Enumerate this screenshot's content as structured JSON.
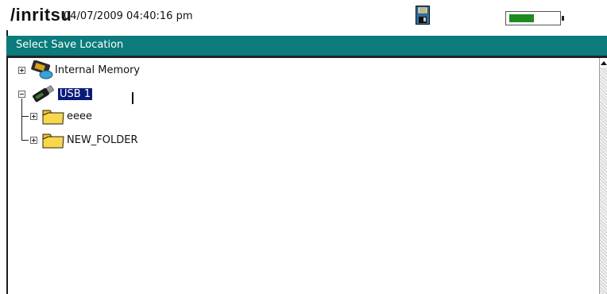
{
  "status_bar": {
    "logo": "/inritsu",
    "datetime": "04/07/2009 04:40:16 pm",
    "disk_icon": "floppy-disk-icon",
    "battery_level": 0.5,
    "battery_color": "#1f8a1f"
  },
  "dialog": {
    "title": "Select Save Location",
    "header_color": "#0b7b7b"
  },
  "tree": {
    "items": [
      {
        "label": "Internal Memory",
        "icon": "memory-card-icon",
        "expander": "plus"
      },
      {
        "label": "USB 1",
        "icon": "usb-drive-icon",
        "expander": "minus",
        "selected": true
      },
      {
        "label": "eeee",
        "icon": "folder-icon",
        "expander": "plus"
      },
      {
        "label": "NEW_FOLDER",
        "icon": "folder-icon",
        "expander": "plus"
      }
    ]
  },
  "scrollbar": {
    "up_icon": "scroll-up-arrow-icon"
  }
}
